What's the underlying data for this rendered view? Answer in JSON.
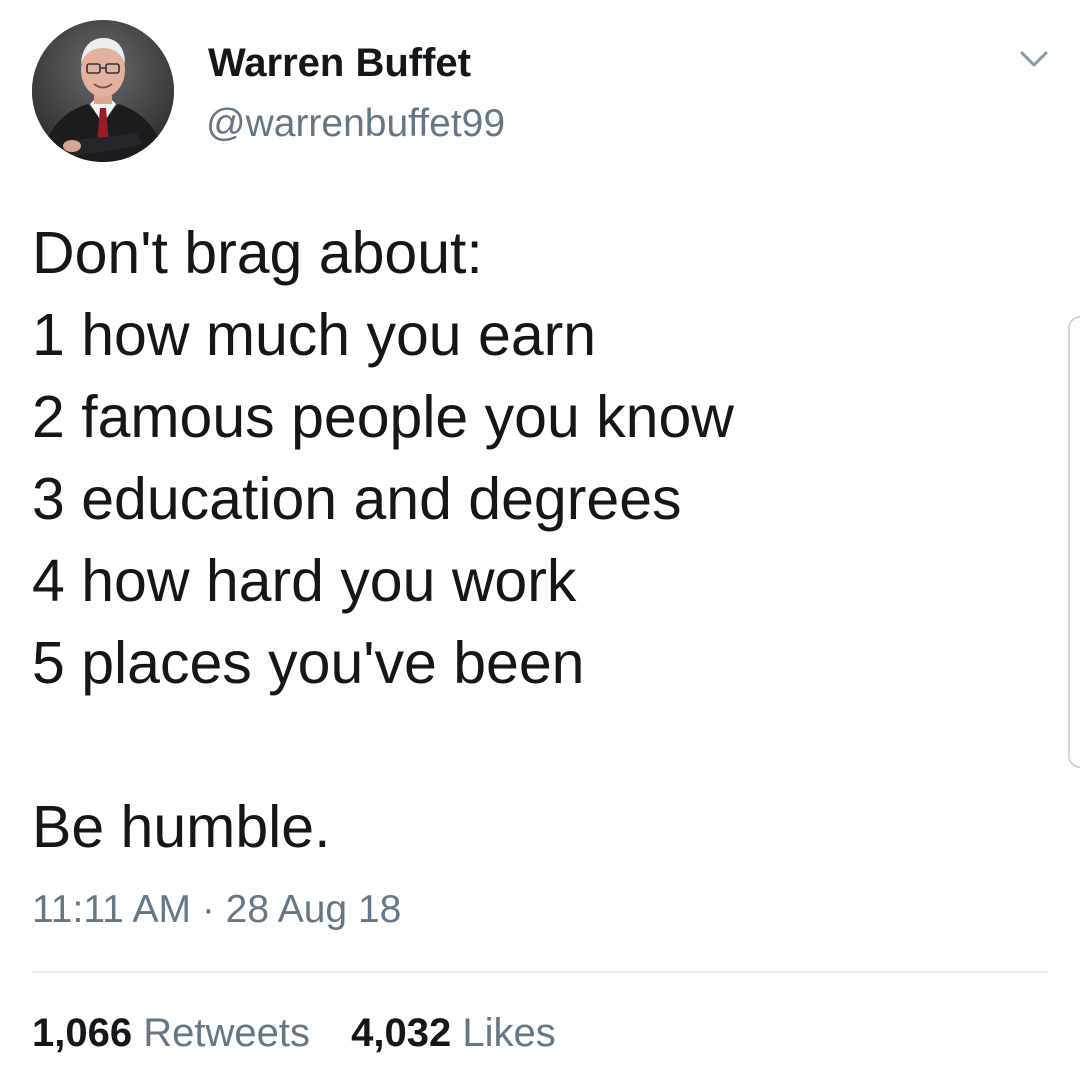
{
  "author": {
    "display_name": "Warren Buffet",
    "handle": "@warrenbuffet99"
  },
  "icons": {
    "avatar": "profile-photo",
    "menu": "chevron-down-icon"
  },
  "tweet": {
    "lines": [
      "Don't brag about:",
      "1 how much you earn",
      "2 famous people you know",
      "3 education and degrees",
      "4 how hard you work",
      "5 places you've been",
      "",
      "Be humble."
    ],
    "timestamp": "11:11 AM · 28 Aug 18"
  },
  "stats": {
    "retweets_count": "1,066",
    "retweets_label": "Retweets",
    "likes_count": "4,032",
    "likes_label": "Likes"
  },
  "colors": {
    "text_primary": "#14171a",
    "text_secondary": "#657786",
    "divider": "#e6ecf0"
  }
}
